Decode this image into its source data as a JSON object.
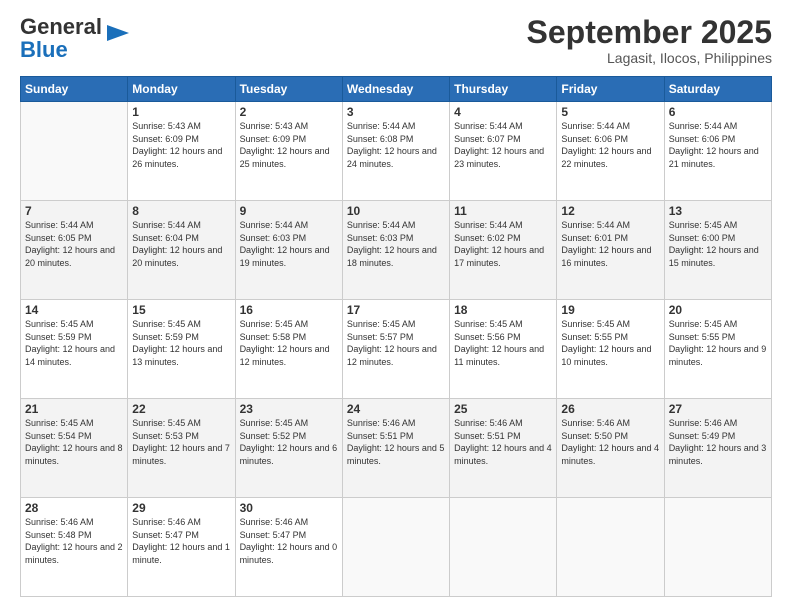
{
  "header": {
    "logo_line1": "General",
    "logo_line2": "Blue",
    "title": "September 2025",
    "subtitle": "Lagasit, Ilocos, Philippines"
  },
  "weekdays": [
    "Sunday",
    "Monday",
    "Tuesday",
    "Wednesday",
    "Thursday",
    "Friday",
    "Saturday"
  ],
  "weeks": [
    [
      {
        "day": "",
        "sunrise": "",
        "sunset": "",
        "daylight": ""
      },
      {
        "day": "1",
        "sunrise": "Sunrise: 5:43 AM",
        "sunset": "Sunset: 6:09 PM",
        "daylight": "Daylight: 12 hours and 26 minutes."
      },
      {
        "day": "2",
        "sunrise": "Sunrise: 5:43 AM",
        "sunset": "Sunset: 6:09 PM",
        "daylight": "Daylight: 12 hours and 25 minutes."
      },
      {
        "day": "3",
        "sunrise": "Sunrise: 5:44 AM",
        "sunset": "Sunset: 6:08 PM",
        "daylight": "Daylight: 12 hours and 24 minutes."
      },
      {
        "day": "4",
        "sunrise": "Sunrise: 5:44 AM",
        "sunset": "Sunset: 6:07 PM",
        "daylight": "Daylight: 12 hours and 23 minutes."
      },
      {
        "day": "5",
        "sunrise": "Sunrise: 5:44 AM",
        "sunset": "Sunset: 6:06 PM",
        "daylight": "Daylight: 12 hours and 22 minutes."
      },
      {
        "day": "6",
        "sunrise": "Sunrise: 5:44 AM",
        "sunset": "Sunset: 6:06 PM",
        "daylight": "Daylight: 12 hours and 21 minutes."
      }
    ],
    [
      {
        "day": "7",
        "sunrise": "Sunrise: 5:44 AM",
        "sunset": "Sunset: 6:05 PM",
        "daylight": "Daylight: 12 hours and 20 minutes."
      },
      {
        "day": "8",
        "sunrise": "Sunrise: 5:44 AM",
        "sunset": "Sunset: 6:04 PM",
        "daylight": "Daylight: 12 hours and 20 minutes."
      },
      {
        "day": "9",
        "sunrise": "Sunrise: 5:44 AM",
        "sunset": "Sunset: 6:03 PM",
        "daylight": "Daylight: 12 hours and 19 minutes."
      },
      {
        "day": "10",
        "sunrise": "Sunrise: 5:44 AM",
        "sunset": "Sunset: 6:03 PM",
        "daylight": "Daylight: 12 hours and 18 minutes."
      },
      {
        "day": "11",
        "sunrise": "Sunrise: 5:44 AM",
        "sunset": "Sunset: 6:02 PM",
        "daylight": "Daylight: 12 hours and 17 minutes."
      },
      {
        "day": "12",
        "sunrise": "Sunrise: 5:44 AM",
        "sunset": "Sunset: 6:01 PM",
        "daylight": "Daylight: 12 hours and 16 minutes."
      },
      {
        "day": "13",
        "sunrise": "Sunrise: 5:45 AM",
        "sunset": "Sunset: 6:00 PM",
        "daylight": "Daylight: 12 hours and 15 minutes."
      }
    ],
    [
      {
        "day": "14",
        "sunrise": "Sunrise: 5:45 AM",
        "sunset": "Sunset: 5:59 PM",
        "daylight": "Daylight: 12 hours and 14 minutes."
      },
      {
        "day": "15",
        "sunrise": "Sunrise: 5:45 AM",
        "sunset": "Sunset: 5:59 PM",
        "daylight": "Daylight: 12 hours and 13 minutes."
      },
      {
        "day": "16",
        "sunrise": "Sunrise: 5:45 AM",
        "sunset": "Sunset: 5:58 PM",
        "daylight": "Daylight: 12 hours and 12 minutes."
      },
      {
        "day": "17",
        "sunrise": "Sunrise: 5:45 AM",
        "sunset": "Sunset: 5:57 PM",
        "daylight": "Daylight: 12 hours and 12 minutes."
      },
      {
        "day": "18",
        "sunrise": "Sunrise: 5:45 AM",
        "sunset": "Sunset: 5:56 PM",
        "daylight": "Daylight: 12 hours and 11 minutes."
      },
      {
        "day": "19",
        "sunrise": "Sunrise: 5:45 AM",
        "sunset": "Sunset: 5:55 PM",
        "daylight": "Daylight: 12 hours and 10 minutes."
      },
      {
        "day": "20",
        "sunrise": "Sunrise: 5:45 AM",
        "sunset": "Sunset: 5:55 PM",
        "daylight": "Daylight: 12 hours and 9 minutes."
      }
    ],
    [
      {
        "day": "21",
        "sunrise": "Sunrise: 5:45 AM",
        "sunset": "Sunset: 5:54 PM",
        "daylight": "Daylight: 12 hours and 8 minutes."
      },
      {
        "day": "22",
        "sunrise": "Sunrise: 5:45 AM",
        "sunset": "Sunset: 5:53 PM",
        "daylight": "Daylight: 12 hours and 7 minutes."
      },
      {
        "day": "23",
        "sunrise": "Sunrise: 5:45 AM",
        "sunset": "Sunset: 5:52 PM",
        "daylight": "Daylight: 12 hours and 6 minutes."
      },
      {
        "day": "24",
        "sunrise": "Sunrise: 5:46 AM",
        "sunset": "Sunset: 5:51 PM",
        "daylight": "Daylight: 12 hours and 5 minutes."
      },
      {
        "day": "25",
        "sunrise": "Sunrise: 5:46 AM",
        "sunset": "Sunset: 5:51 PM",
        "daylight": "Daylight: 12 hours and 4 minutes."
      },
      {
        "day": "26",
        "sunrise": "Sunrise: 5:46 AM",
        "sunset": "Sunset: 5:50 PM",
        "daylight": "Daylight: 12 hours and 4 minutes."
      },
      {
        "day": "27",
        "sunrise": "Sunrise: 5:46 AM",
        "sunset": "Sunset: 5:49 PM",
        "daylight": "Daylight: 12 hours and 3 minutes."
      }
    ],
    [
      {
        "day": "28",
        "sunrise": "Sunrise: 5:46 AM",
        "sunset": "Sunset: 5:48 PM",
        "daylight": "Daylight: 12 hours and 2 minutes."
      },
      {
        "day": "29",
        "sunrise": "Sunrise: 5:46 AM",
        "sunset": "Sunset: 5:47 PM",
        "daylight": "Daylight: 12 hours and 1 minute."
      },
      {
        "day": "30",
        "sunrise": "Sunrise: 5:46 AM",
        "sunset": "Sunset: 5:47 PM",
        "daylight": "Daylight: 12 hours and 0 minutes."
      },
      {
        "day": "",
        "sunrise": "",
        "sunset": "",
        "daylight": ""
      },
      {
        "day": "",
        "sunrise": "",
        "sunset": "",
        "daylight": ""
      },
      {
        "day": "",
        "sunrise": "",
        "sunset": "",
        "daylight": ""
      },
      {
        "day": "",
        "sunrise": "",
        "sunset": "",
        "daylight": ""
      }
    ]
  ]
}
